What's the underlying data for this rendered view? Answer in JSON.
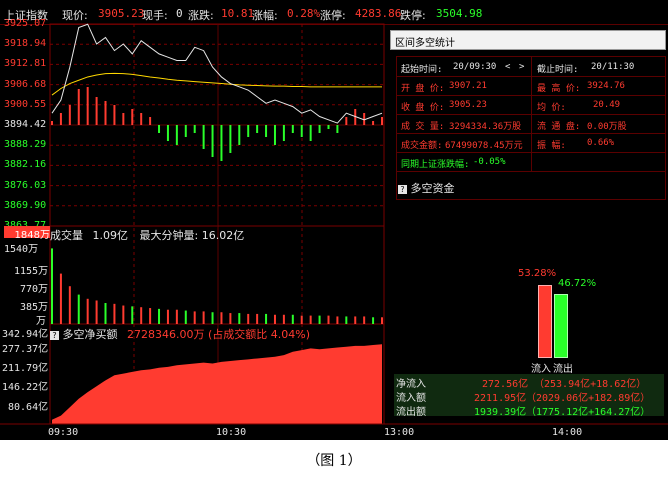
{
  "header": {
    "index_name": "上证指数",
    "price_label": "现价:",
    "price_value": "3905.23",
    "volume_label": "现手:",
    "volume_value": "0",
    "change_label": "涨跌:",
    "change_value": "10.81",
    "pct_label": "涨幅:",
    "pct_value": "0.28%",
    "limit_up_label": "涨停:",
    "limit_up_value": "4283.86",
    "limit_down_label": "跌停:",
    "limit_down_value": "3504.98"
  },
  "price_chart": {
    "y_ticks": [
      "3925.07",
      "3918.94",
      "3912.81",
      "3906.68",
      "3900.55",
      "3894.42",
      "3888.29",
      "3882.16",
      "3876.03",
      "3869.90",
      "3863.77"
    ],
    "price": [
      3898,
      3902,
      3912,
      3924,
      3925,
      3919,
      3921,
      3917,
      3919,
      3916,
      3920,
      3918,
      3916,
      3915,
      3914,
      3914,
      3918,
      3917,
      3912,
      3909,
      3907,
      3906,
      3905,
      3903,
      3901,
      3902,
      3901,
      3900,
      3898,
      3899,
      3897,
      3896,
      3895,
      3898,
      3897,
      3896,
      3897,
      3898
    ],
    "avg": [
      3903.5,
      3905.5,
      3907.0,
      3908.0,
      3909.0,
      3909.6,
      3910.0,
      3910.1,
      3910.0,
      3909.8,
      3909.4,
      3909.0,
      3908.7,
      3908.3,
      3908.0,
      3907.8,
      3907.6,
      3907.4,
      3907.2,
      3907.0,
      3906.8,
      3906.6,
      3906.5,
      3906.4,
      3906.3,
      3906.2,
      3906.2,
      3906.1,
      3906.1,
      3906.0,
      3906.0,
      3906.0,
      3906.0,
      3906.0,
      3906.0,
      3906.0,
      3906.0,
      3906.0
    ],
    "ratio": [
      0.1,
      0.3,
      0.5,
      0.9,
      0.95,
      0.7,
      0.6,
      0.5,
      0.3,
      0.4,
      0.3,
      0.2,
      -0.2,
      -0.4,
      -0.5,
      -0.3,
      -0.2,
      -0.6,
      -0.8,
      -0.9,
      -0.7,
      -0.5,
      -0.3,
      -0.2,
      -0.3,
      -0.5,
      -0.4,
      -0.2,
      -0.3,
      -0.4,
      -0.2,
      -0.1,
      -0.2,
      0.2,
      0.4,
      0.3,
      0.1,
      0.2
    ]
  },
  "volume_chart": {
    "title": "成交量",
    "value": "1.09亿",
    "max_label": "最大分钟量:",
    "max_value": "16.02亿",
    "y_ticks": [
      "1848万",
      "1540万",
      "1155万",
      "770万",
      "385万",
      "万"
    ],
    "bars": [
      0.9,
      0.6,
      0.45,
      0.35,
      0.3,
      0.28,
      0.25,
      0.24,
      0.22,
      0.21,
      0.2,
      0.19,
      0.18,
      0.17,
      0.17,
      0.16,
      0.15,
      0.15,
      0.14,
      0.14,
      0.13,
      0.13,
      0.12,
      0.12,
      0.12,
      0.11,
      0.11,
      0.11,
      0.1,
      0.1,
      0.1,
      0.1,
      0.09,
      0.09,
      0.09,
      0.09,
      0.08,
      0.08
    ]
  },
  "net_chart": {
    "title": "多空净买额",
    "value": "2728346.00万",
    "note": "(占成交额比 4.04%)",
    "y_ticks": [
      "342.94亿",
      "277.37亿",
      "211.79亿",
      "146.22亿",
      "80.64亿"
    ],
    "values": [
      0.05,
      0.1,
      0.2,
      0.3,
      0.38,
      0.45,
      0.52,
      0.58,
      0.6,
      0.62,
      0.64,
      0.65,
      0.67,
      0.68,
      0.7,
      0.71,
      0.72,
      0.73,
      0.72,
      0.74,
      0.75,
      0.76,
      0.77,
      0.78,
      0.79,
      0.8,
      0.82,
      0.86,
      0.88,
      0.9,
      0.89,
      0.9,
      0.91,
      0.92,
      0.93,
      0.93,
      0.94,
      0.95
    ]
  },
  "time_axis": [
    "09:30",
    "10:30",
    "13:00",
    "14:00"
  ],
  "stats_panel": {
    "title": "区间多空统计",
    "start_label": "起始时间:",
    "start_value": "20/09:30",
    "end_label": "截止时间:",
    "end_value": "20/11:30",
    "open_label": "开 盘 价:",
    "open_value": "3907.21",
    "high_label": "最 高 价:",
    "high_value": "3924.76",
    "close_label": "收 盘 价:",
    "close_value": "3905.23",
    "avg_label": "均    价:",
    "avg_value": "20.49",
    "vol_label": "成 交 量:",
    "vol_value": "3294334.36万股",
    "float_label": "流 通 盘:",
    "float_value": "0.00万股",
    "amount_label": "成交金额:",
    "amount_value": "67499078.45万元",
    "amp_label": "振    幅:",
    "amp_value": "0.66%",
    "same_label": "同期上证涨跌幅:",
    "same_value": "-0.05%"
  },
  "fund_panel": {
    "title": "多空资金",
    "inflow_pct": "53.28%",
    "outflow_pct": "46.72%",
    "inflow_ratio": 0.5328,
    "outflow_ratio": 0.4672,
    "inflow_label": "流入",
    "outflow_label": "流出",
    "rows": [
      {
        "label": "净流入",
        "value": "272.56亿",
        "detail": "（253.94亿+18.62亿）"
      },
      {
        "label": "流入额",
        "value": "2211.95亿",
        "detail": "（2029.06亿+182.89亿）"
      },
      {
        "label": "流出额",
        "value": "1939.39亿",
        "detail": "（1775.12亿+164.27亿）"
      }
    ]
  },
  "caption": "（图 1）",
  "colors": {
    "bg": "#000000",
    "up": "#ff3b30",
    "down": "#2aff2a",
    "avg": "#ffd800",
    "grid": "#5b0000"
  }
}
